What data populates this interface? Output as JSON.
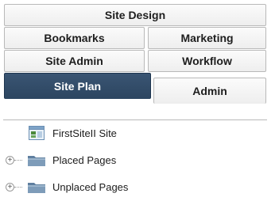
{
  "tabs": {
    "site_design": "Site Design",
    "bookmarks": "Bookmarks",
    "marketing": "Marketing",
    "site_admin": "Site Admin",
    "workflow": "Workflow",
    "site_plan": "Site Plan",
    "admin": "Admin",
    "active_tab": "Site Plan"
  },
  "tree": {
    "items": [
      {
        "label": "FirstSiteII Site",
        "icon": "site-icon",
        "expandable": false
      },
      {
        "label": "Placed Pages",
        "icon": "folder-icon",
        "expandable": true,
        "expander": "+"
      },
      {
        "label": "Unplaced Pages",
        "icon": "folder-icon",
        "expandable": true,
        "expander": "+"
      }
    ]
  },
  "colors": {
    "active_tab_bg": "#2f4a66",
    "tab_bg": "#f4f4f4",
    "folder": "#6f8fb0"
  }
}
